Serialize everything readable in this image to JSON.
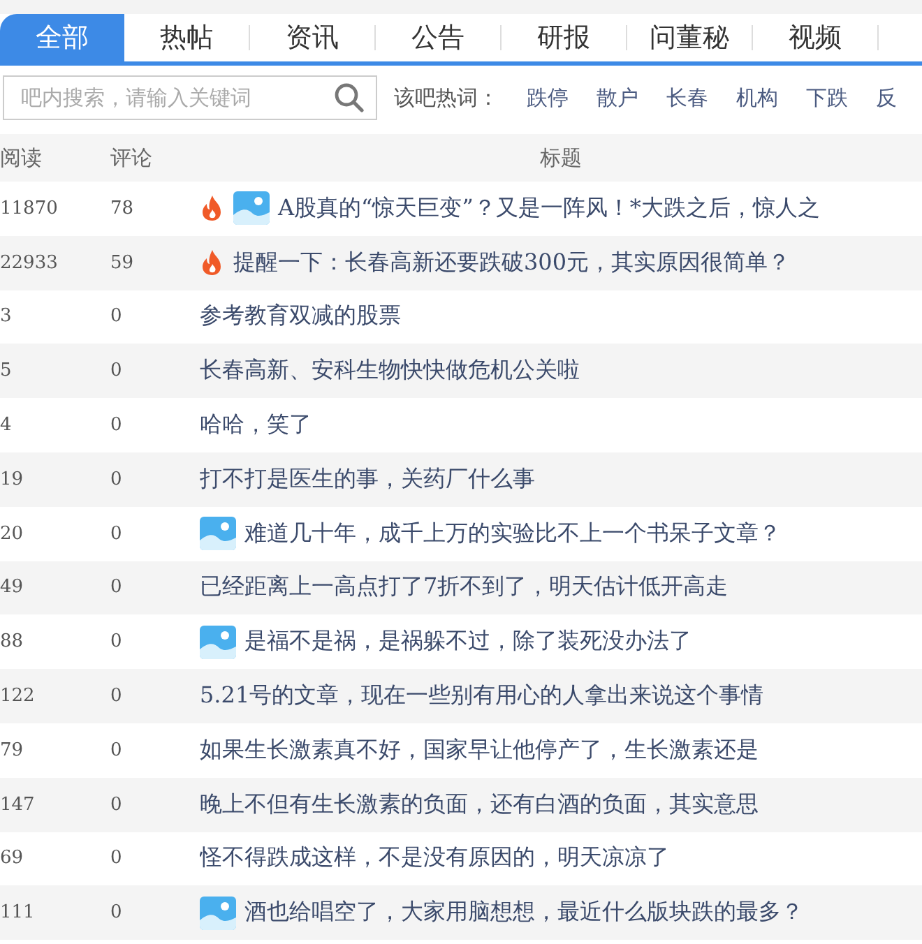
{
  "tabs": [
    {
      "label": "全部",
      "selected": true
    },
    {
      "label": "热帖",
      "selected": false
    },
    {
      "label": "资讯",
      "selected": false
    },
    {
      "label": "公告",
      "selected": false
    },
    {
      "label": "研报",
      "selected": false
    },
    {
      "label": "问董秘",
      "selected": false
    },
    {
      "label": "视频",
      "selected": false
    }
  ],
  "search": {
    "placeholder": "吧内搜索，请输入关键词"
  },
  "hot_words": {
    "label": "该吧热词：",
    "words": [
      "跌停",
      "散户",
      "长春",
      "机构",
      "下跌",
      "反"
    ]
  },
  "table": {
    "columns": [
      "阅读",
      "评论",
      "标题"
    ],
    "rows": [
      {
        "reads": "11870",
        "comments": "78",
        "hot": true,
        "has_picture": true,
        "title": "A股真的“惊天巨变”？又是一阵风！*大跌之后，惊人之"
      },
      {
        "reads": "22933",
        "comments": "59",
        "hot": true,
        "has_picture": false,
        "title": "提醒一下：长春高新还要跌破300元，其实原因很简单？"
      },
      {
        "reads": "3",
        "comments": "0",
        "hot": false,
        "has_picture": false,
        "title": "参考教育双减的股票"
      },
      {
        "reads": "5",
        "comments": "0",
        "hot": false,
        "has_picture": false,
        "title": "长春高新、安科生物快快做危机公关啦"
      },
      {
        "reads": "4",
        "comments": "0",
        "hot": false,
        "has_picture": false,
        "title": "哈哈，笑了"
      },
      {
        "reads": "19",
        "comments": "0",
        "hot": false,
        "has_picture": false,
        "title": "打不打是医生的事，关药厂什么事"
      },
      {
        "reads": "20",
        "comments": "0",
        "hot": false,
        "has_picture": true,
        "title": "难道几十年，成千上万的实验比不上一个书呆子文章？"
      },
      {
        "reads": "49",
        "comments": "0",
        "hot": false,
        "has_picture": false,
        "title": "已经距离上一高点打了7折不到了，明天估计低开高走"
      },
      {
        "reads": "88",
        "comments": "0",
        "hot": false,
        "has_picture": true,
        "title": "是福不是祸，是祸躲不过，除了装死没办法了"
      },
      {
        "reads": "122",
        "comments": "0",
        "hot": false,
        "has_picture": false,
        "title": "5.21号的文章，现在一些别有用心的人拿出来说这个事情"
      },
      {
        "reads": "79",
        "comments": "0",
        "hot": false,
        "has_picture": false,
        "title": "如果生长激素真不好，国家早让他停产了，生长激素还是"
      },
      {
        "reads": "147",
        "comments": "0",
        "hot": false,
        "has_picture": false,
        "title": "晚上不但有生长激素的负面，还有白酒的负面，其实意思"
      },
      {
        "reads": "69",
        "comments": "0",
        "hot": false,
        "has_picture": false,
        "title": "怪不得跌成这样，不是没有原因的，明天凉凉了"
      },
      {
        "reads": "111",
        "comments": "0",
        "hot": false,
        "has_picture": true,
        "title": "酒也给唱空了，大家用脑想想，最近什么版块跌的最多？"
      }
    ]
  }
}
